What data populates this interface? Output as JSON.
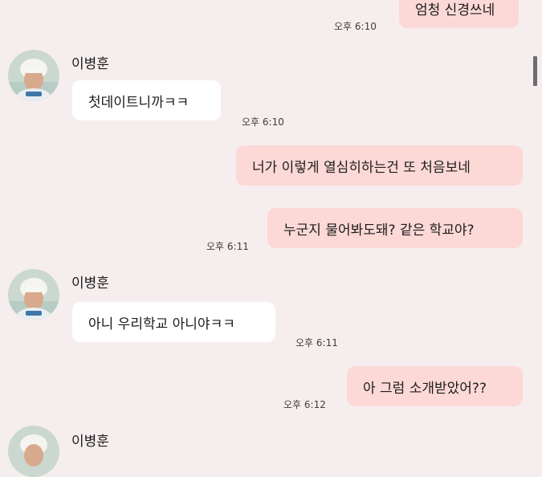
{
  "chat": {
    "messages": [
      {
        "sender": "me",
        "text": "엄청 신경쓰네",
        "time": "오후 6:10"
      },
      {
        "sender": "이병훈",
        "text": "첫데이트니까ㅋㅋ",
        "time": "오후 6:10"
      },
      {
        "sender": "me",
        "text": "너가 이렇게 열심히하는건 또 처음보네"
      },
      {
        "sender": "me",
        "text": "누군지 물어봐도돼? 같은 학교야?",
        "time": "오후 6:11"
      },
      {
        "sender": "이병훈",
        "text": "아니 우리학교 아니야ㅋㅋ",
        "time": "오후 6:11"
      },
      {
        "sender": "me",
        "text": "아 그럼 소개받았어??",
        "time": "오후 6:12"
      },
      {
        "sender": "이병훈"
      }
    ]
  },
  "colors": {
    "background": "#f6eeee",
    "my_bubble": "#fcd9d6",
    "their_bubble": "#ffffff",
    "scrollbar": "#6d6d6d"
  },
  "icons": {
    "avatar": "profile-photo",
    "scrollbar": "scrollbar-thumb"
  }
}
